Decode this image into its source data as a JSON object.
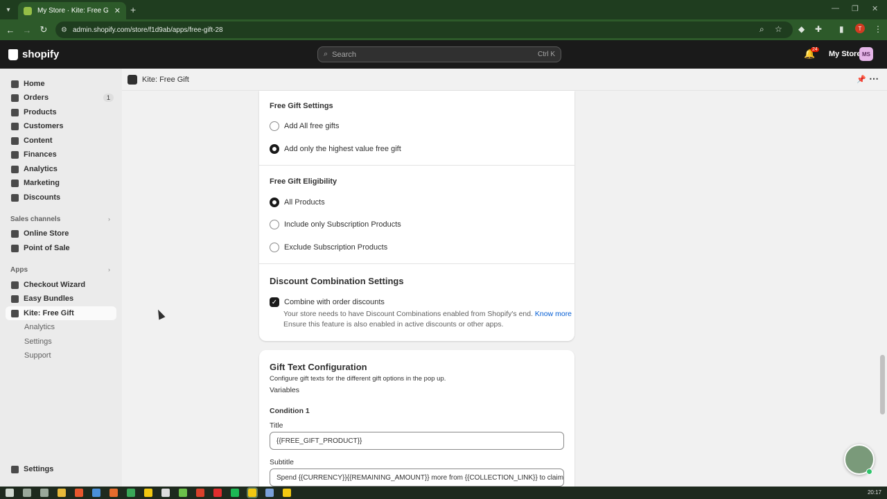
{
  "browser": {
    "tab_title": "My Store · Kite: Free Gift - Shopify",
    "url": "admin.shopify.com/store/f1d9ab/apps/free-gift-28",
    "profile_initial": "T"
  },
  "topbar": {
    "logo_text": "shopify",
    "search_placeholder": "Search",
    "search_shortcut": "Ctrl K",
    "notification_count": "24",
    "store_name": "My Store",
    "store_initials": "MS"
  },
  "sidebar": {
    "items": [
      {
        "label": "Home"
      },
      {
        "label": "Orders",
        "count": "1"
      },
      {
        "label": "Products"
      },
      {
        "label": "Customers"
      },
      {
        "label": "Content"
      },
      {
        "label": "Finances"
      },
      {
        "label": "Analytics"
      },
      {
        "label": "Marketing"
      },
      {
        "label": "Discounts"
      }
    ],
    "sales_channels_heading": "Sales channels",
    "sales_channels": [
      {
        "label": "Online Store"
      },
      {
        "label": "Point of Sale"
      }
    ],
    "apps_heading": "Apps",
    "apps": [
      {
        "label": "Checkout Wizard"
      },
      {
        "label": "Easy Bundles"
      },
      {
        "label": "Kite: Free Gift"
      }
    ],
    "app_sub": [
      {
        "label": "Analytics"
      },
      {
        "label": "Settings"
      },
      {
        "label": "Support"
      }
    ],
    "settings_label": "Settings"
  },
  "app_header": {
    "title": "Kite: Free Gift"
  },
  "settings_card": {
    "free_gift_settings": {
      "heading": "Free Gift Settings",
      "options": [
        {
          "label": "Add All free gifts",
          "selected": false
        },
        {
          "label": "Add only the highest value free gift",
          "selected": true
        }
      ]
    },
    "eligibility": {
      "heading": "Free Gift Eligibility",
      "options": [
        {
          "label": "All Products",
          "selected": true
        },
        {
          "label": "Include only Subscription Products",
          "selected": false
        },
        {
          "label": "Exclude Subscription Products",
          "selected": false
        }
      ]
    },
    "discount": {
      "heading": "Discount Combination Settings",
      "checkbox_label": "Combine with order discounts",
      "help_line1": "Your store needs to have Discount Combinations enabled from Shopify's end.",
      "help_link": "Know more",
      "help_line2": "Ensure this feature is also enabled in active discounts or other apps."
    }
  },
  "gift_text_card": {
    "heading": "Gift Text Configuration",
    "description": "Configure gift texts for the different gift options in the pop up.",
    "variables_link": "Variables",
    "condition_heading": "Condition 1",
    "title_label": "Title",
    "title_value": "{{FREE_GIFT_PRODUCT}}",
    "subtitle_label": "Subtitle",
    "subtitle_value": "Spend {{CURRENCY}}{{REMAINING_AMOUNT}} more from {{COLLECTION_LINK}} to claim!"
  },
  "taskbar": {
    "clock": "20:17"
  }
}
